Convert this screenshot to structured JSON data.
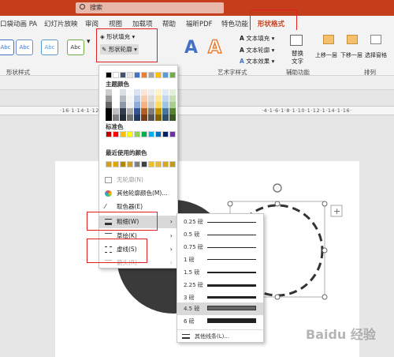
{
  "search": {
    "label": "搜索"
  },
  "tabs": [
    "口袋动画 PA",
    "幻灯片放映",
    "审阅",
    "视图",
    "加载项",
    "帮助",
    "福昕PDF",
    "特色功能",
    "形状格式"
  ],
  "ribbon": {
    "style_sample": "Abc",
    "shape_styles_group": "形状样式",
    "shape_fill": "形状填充",
    "shape_outline": "形状轮廓",
    "wordart_letter": "A",
    "wordart_group": "艺术字样式",
    "text_fill": "文本填充",
    "text_outline": "文本轮廓",
    "text_effects": "文本效果",
    "alt_text": "替换文字",
    "alt_text_line1": "替换",
    "alt_text_line2": "文字",
    "accessibility_group": "辅助功能",
    "bring_forward": "上移一层",
    "send_backward": "下移一层",
    "selection_pane": "选择窗格",
    "arrange_group": "排列"
  },
  "ruler": {
    "left_marks": "·16·1·14·1·12·1·10·1·8·1·6·1",
    "right_marks": "·4·1·6·1·8·1·10·1·12·1·14·1·16·"
  },
  "outline_menu": {
    "theme_colors": "主题颜色",
    "standard_colors": "标准色",
    "recent_colors": "最近使用的颜色",
    "no_outline": "无轮廓(N)",
    "more_colors": "其他轮廓颜色(M)...",
    "eyedropper": "取色器(E)",
    "weight": "粗细(W)",
    "sketched": "草绘(K)",
    "dashes": "虚线(S)",
    "arrows": "箭头(R)",
    "theme_row": [
      "#000000",
      "#ffffff",
      "#44546a",
      "#e7e6e6",
      "#4472c4",
      "#ed7d31",
      "#a5a5a5",
      "#ffc000",
      "#5b9bd5",
      "#70ad47"
    ],
    "standard_row": [
      "#c00000",
      "#ff0000",
      "#ffc000",
      "#ffff00",
      "#92d050",
      "#00b050",
      "#00b0f0",
      "#0070c0",
      "#002060",
      "#7030a0"
    ],
    "recent_row": [
      "#d4a017",
      "#e0a800",
      "#b8860b",
      "#c9a227",
      "#808080",
      "#404040",
      "#f0c020",
      "#e8b830",
      "#d9a520",
      "#c49a17"
    ]
  },
  "weight_menu": {
    "items": [
      "0.25 磅",
      "0.5 磅",
      "0.75 磅",
      "1 磅",
      "1.5 磅",
      "2.25 磅",
      "3 磅",
      "4.5 磅",
      "6 磅"
    ],
    "more_lines": "其他线条(L)..."
  },
  "watermark": "Baidu 经验"
}
